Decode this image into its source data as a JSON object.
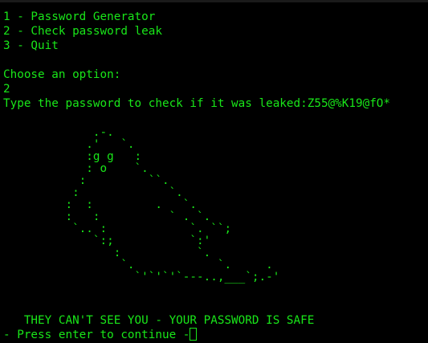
{
  "terminal": {
    "menu": [
      "1 - Password Generator",
      "2 - Check password leak",
      "3 - Quit"
    ],
    "choose_prompt": "Choose an option:",
    "choice_input": "2",
    "password_prompt": "Type the password to check if it was leaked:Z55@%K19@fO*",
    "ascii_art": "             .-.\n            .'   `.\n            :g g   :\n            : o    `.\n           :         ``.\n          :             `.\n         :  :         .   `.\n         :   :          ` . `.\n          `.. :            `. ``;\n             `:;           `:'\n                :           `.\n                 `.            `.     .\n                   `'`'`'`---..,___`;.-'",
    "safe_message": "   THEY CAN'T SEE YOU - YOUR PASSWORD IS SAFE",
    "continue_prompt": "- Press enter to continue -"
  },
  "colors": {
    "background": "#000000",
    "text": "#19e619"
  }
}
